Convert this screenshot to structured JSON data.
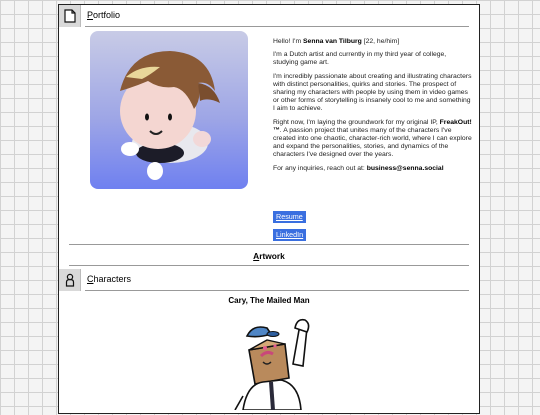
{
  "portfolio": {
    "title_first": "P",
    "title_rest": "ortfolio"
  },
  "intro": {
    "greeting": "Hello! I'm ",
    "name": "Senna van Tilburg",
    "age_pronouns": " [22, he/him]",
    "p1": "I'm a Dutch artist and currently in my third year of college, studying game art.",
    "p2": "I'm incredibly passionate about creating and illustrating characters with distinct personalities, quirks and stories. The prospect of sharing my characters with people by using them in video games or other forms of storytelling is insanely cool to me and something I aim to achieve.",
    "p3_a": "Right now, I'm laying the groundwork for my original IP, ",
    "p3_ip": "FreakOut!™",
    "p3_b": ". A passion project that unites many of the characters I've created into one chaotic, character-rich world, where I can explore and expand the personalities, stories, and dynamics of the characters I've designed over the years.",
    "p4_a": "For any inquiries, reach out at: ",
    "p4_email": "business@senna.social"
  },
  "buttons": {
    "resume": "Resume",
    "linkedin": "LinkedIn"
  },
  "artwork": {
    "title_first": "A",
    "title_rest": "rtwork"
  },
  "characters": {
    "title_first": "C",
    "title_rest": "haracters"
  },
  "featured_art": {
    "name": "Cary, The Mailed Man"
  },
  "colors": {
    "button": "#3a6fe0",
    "avatar_bg_top": "#c8cbe6",
    "avatar_bg_bottom": "#6f80f0"
  },
  "icons": {
    "portfolio": "document-icon",
    "characters": "person-icon"
  }
}
